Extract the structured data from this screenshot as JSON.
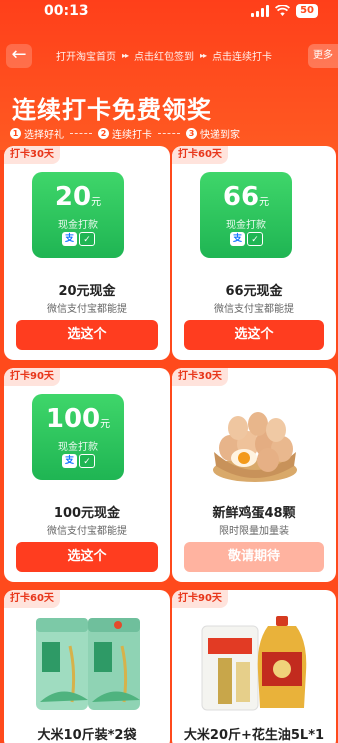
{
  "status": {
    "time": "00:13",
    "battery": "50"
  },
  "nav": {
    "back_label": "←",
    "crumbs": [
      "打开淘宝首页",
      "点击红包签到",
      "点击连续打卡"
    ],
    "crumb_sep": "▸▸",
    "more_label": "更多"
  },
  "headline": "连续打卡免费领奖",
  "steps": [
    {
      "num": "1",
      "label": "选择好礼"
    },
    {
      "num": "2",
      "label": "连续打卡"
    },
    {
      "num": "3",
      "label": "快递到家"
    }
  ],
  "cards": [
    {
      "tag": "打卡30天",
      "cash_amount": "20",
      "cash_unit": "元",
      "cash_sub": "现金打款",
      "title": "20元现金",
      "subtitle": "微信支付宝都能提",
      "button": "选这个",
      "button_disabled": false
    },
    {
      "tag": "打卡60天",
      "cash_amount": "66",
      "cash_unit": "元",
      "cash_sub": "现金打款",
      "title": "66元现金",
      "subtitle": "微信支付宝都能提",
      "button": "选这个",
      "button_disabled": false
    },
    {
      "tag": "打卡90天",
      "cash_amount": "100",
      "cash_unit": "元",
      "cash_sub": "现金打款",
      "title": "100元现金",
      "subtitle": "微信支付宝都能提",
      "button": "选这个",
      "button_disabled": false
    },
    {
      "tag": "打卡30天",
      "title": "新鲜鸡蛋48颗",
      "subtitle": "限时限量加量装",
      "button": "敬请期待",
      "button_disabled": true
    },
    {
      "tag": "打卡60天",
      "title": "大米10斤装*2袋"
    },
    {
      "tag": "打卡90天",
      "title": "大米20斤+花生油5L*1"
    }
  ],
  "pay_badges": {
    "alipay": "支",
    "wechat": "✓"
  },
  "colors": {
    "brand": "#ff4a1c",
    "button": "#ff3d1f",
    "button_disabled": "#ffb3a0",
    "cash_green": "#1fb553",
    "tag_bg": "#ffe3dc"
  }
}
